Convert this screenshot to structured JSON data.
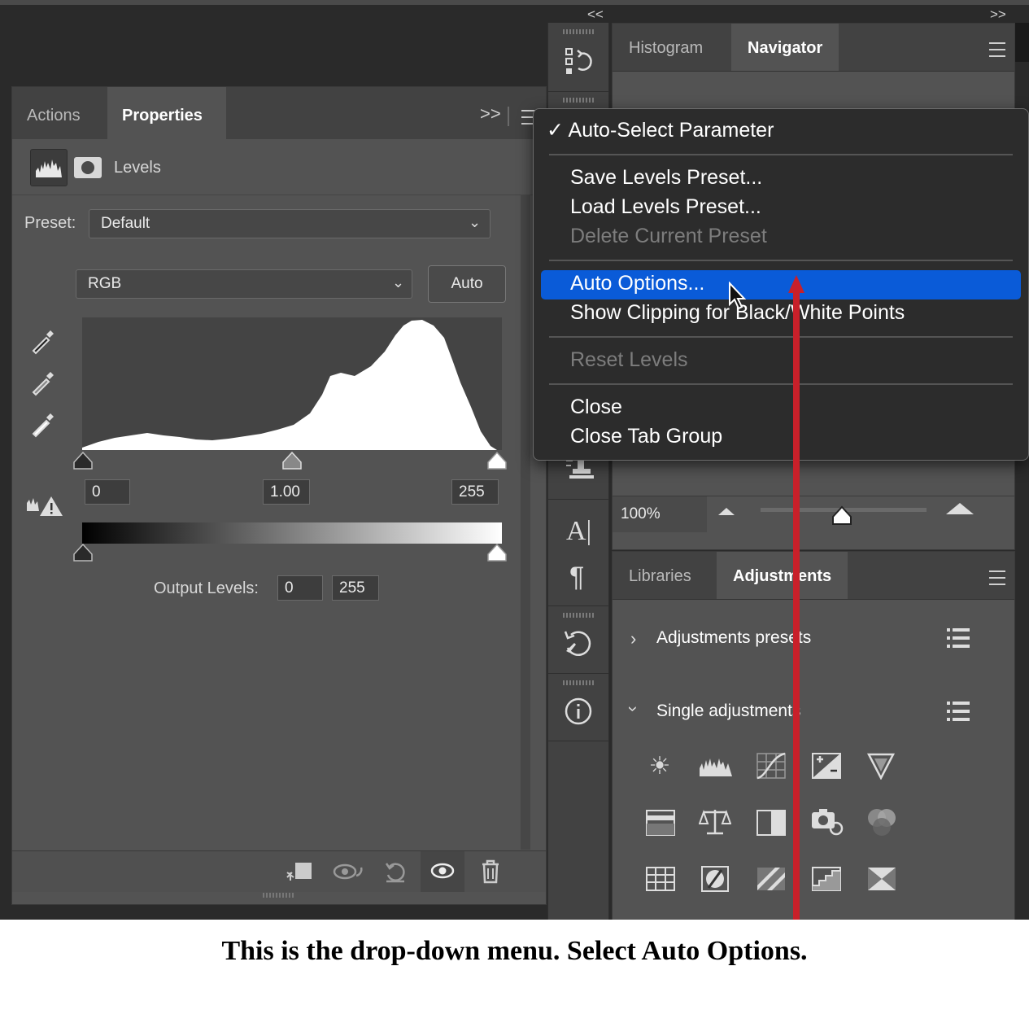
{
  "properties_panel": {
    "tabs": [
      {
        "label": "Actions",
        "active": false
      },
      {
        "label": "Properties",
        "active": true
      }
    ],
    "expand_glyph": ">>",
    "layer_title": "Levels",
    "preset_label": "Preset:",
    "preset_value": "Default",
    "channel_value": "RGB",
    "auto_label": "Auto",
    "input_black": "0",
    "input_gamma": "1.00",
    "input_white": "255",
    "output_label": "Output Levels:",
    "output_black": "0",
    "output_white": "255"
  },
  "top_panel": {
    "collapse_left": "<<",
    "collapse_right": ">>",
    "tabs": [
      {
        "label": "Histogram",
        "active": false
      },
      {
        "label": "Navigator",
        "active": true
      }
    ],
    "zoom_value": "100%"
  },
  "lower_panel": {
    "tabs": [
      {
        "label": "Libraries",
        "active": false
      },
      {
        "label": "Adjustments",
        "active": true
      }
    ],
    "presets_label": "Adjustments presets",
    "single_label": "Single adjustments"
  },
  "menu": {
    "items": [
      {
        "label": "✓ Auto-Select Parameter",
        "disabled": false,
        "checked": true
      },
      {
        "label": "Save Levels Preset...",
        "disabled": false
      },
      {
        "label": "Load Levels Preset...",
        "disabled": false
      },
      {
        "label": "Delete Current Preset",
        "disabled": true
      },
      {
        "label": "Auto Options...",
        "disabled": false,
        "highlighted": true
      },
      {
        "label": "Show Clipping for Black/White Points",
        "disabled": false
      },
      {
        "label": "Reset Levels",
        "disabled": true
      },
      {
        "label": "Close",
        "disabled": false
      },
      {
        "label": "Close Tab Group",
        "disabled": false
      }
    ],
    "highlight_color": "#0a5bd8"
  },
  "annotation": {
    "arrow_color": "#c8202a",
    "caption": "This is the drop-down menu. Select Auto Options."
  }
}
